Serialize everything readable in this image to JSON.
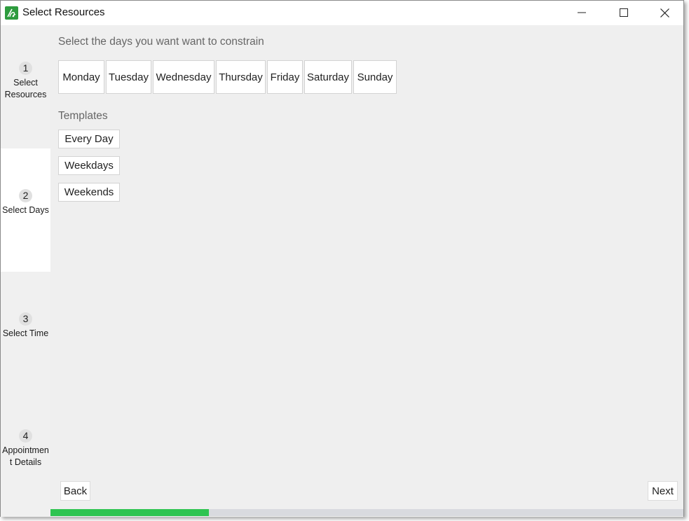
{
  "window": {
    "title": "Select Resources",
    "accent_color": "#2e9c3e"
  },
  "titlebar_buttons": [
    "minimize-icon",
    "maximize-icon",
    "close-icon"
  ],
  "steps": [
    {
      "number": "1",
      "label": "Select Resources"
    },
    {
      "number": "2",
      "label": "Select Days",
      "active": true
    },
    {
      "number": "3",
      "label": "Select Time"
    },
    {
      "number": "4",
      "label": "Appointmen t Details"
    }
  ],
  "main": {
    "instructions": "Select the days you want want to constrain",
    "days": [
      "Monday",
      "Tuesday",
      "Wednesday",
      "Thursday",
      "Friday",
      "Saturday",
      "Sunday"
    ],
    "templates_label": "Templates",
    "templates": [
      "Every Day",
      "Weekdays",
      "Weekends"
    ]
  },
  "nav": {
    "back_label": "Back",
    "next_label": "Next"
  },
  "progress": {
    "fraction": 0.25,
    "fill_color": "#2fc451"
  }
}
